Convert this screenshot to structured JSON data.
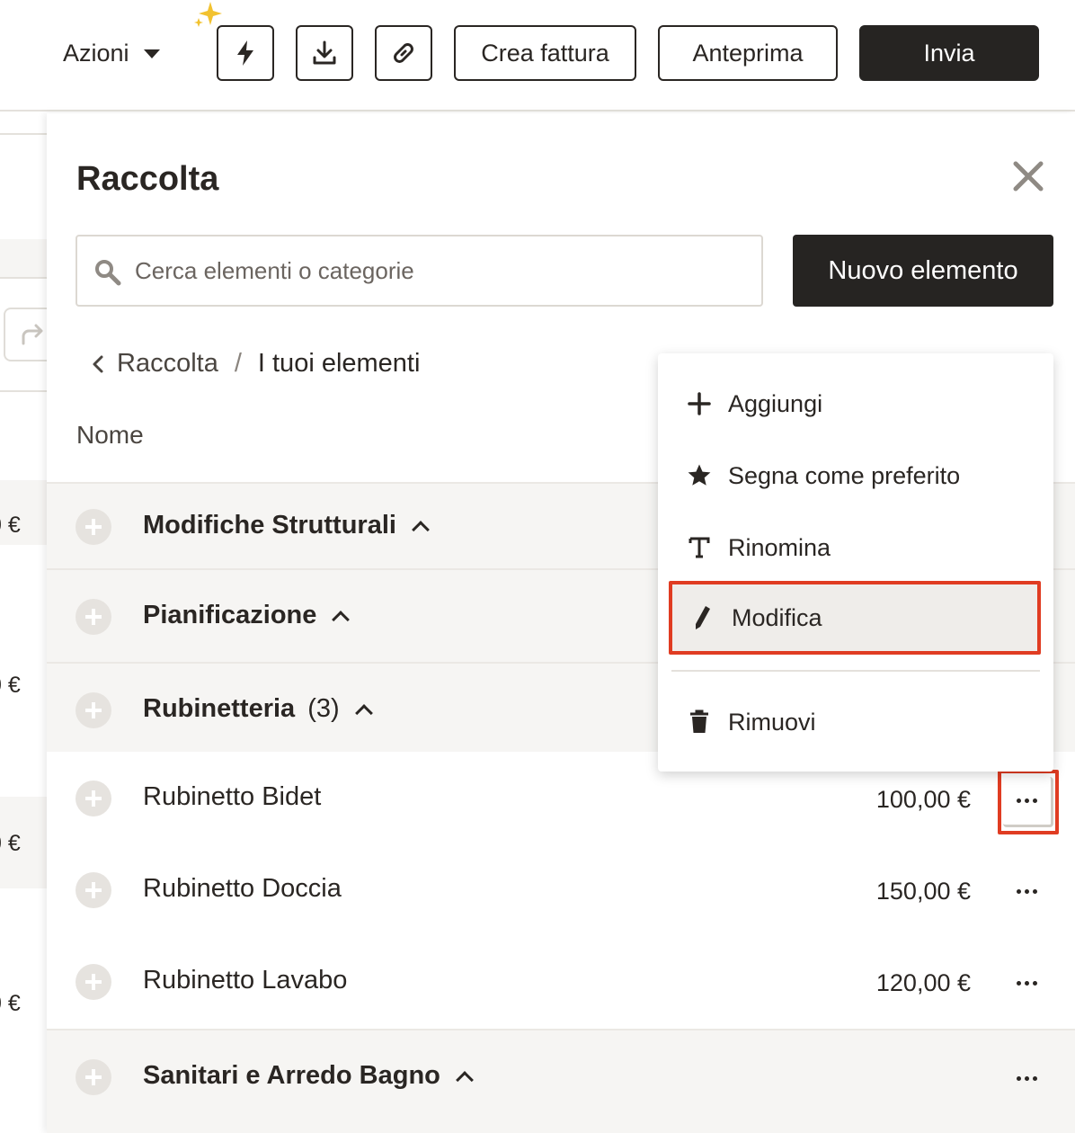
{
  "toolbar": {
    "actions_label": "Azioni",
    "create_invoice_label": "Crea fattura",
    "preview_label": "Anteprima",
    "send_label": "Invia",
    "icons": [
      "bolt-icon",
      "download-icon",
      "link-icon",
      "sparkle-icon"
    ]
  },
  "background": {
    "values": [
      "0 €",
      "0 €",
      "0 €",
      "0 €"
    ]
  },
  "drawer": {
    "title": "Raccolta",
    "search_placeholder": "Cerca elementi o categorie",
    "new_item_label": "Nuovo elemento",
    "breadcrumb": {
      "parent": "Raccolta",
      "separator": "/",
      "current": "I tuoi elementi"
    },
    "column_name": "Nome"
  },
  "rows": [
    {
      "type": "category",
      "name": "Modifiche Strutturali",
      "count": ""
    },
    {
      "type": "category",
      "name": "Pianificazione",
      "count": ""
    },
    {
      "type": "category",
      "name": "Rubinetteria",
      "count": "(3)"
    },
    {
      "type": "item",
      "name": "Rubinetto Bidet",
      "price": "100,00 €"
    },
    {
      "type": "item",
      "name": "Rubinetto Doccia",
      "price": "150,00 €"
    },
    {
      "type": "item",
      "name": "Rubinetto Lavabo",
      "price": "120,00 €"
    },
    {
      "type": "category",
      "name": "Sanitari e Arredo Bagno",
      "count": ""
    }
  ],
  "menu": {
    "items": [
      {
        "label": "Aggiungi",
        "icon": "plus-icon"
      },
      {
        "label": "Segna come preferito",
        "icon": "star-icon"
      },
      {
        "label": "Rinomina",
        "icon": "text-icon"
      },
      {
        "label": "Modifica",
        "icon": "pencil-icon",
        "highlighted": true
      },
      {
        "label": "Rimuovi",
        "icon": "trash-icon"
      }
    ]
  },
  "colors": {
    "accent_dark": "#262422",
    "highlight_border": "#e03c22",
    "category_bg": "#f6f5f3"
  }
}
